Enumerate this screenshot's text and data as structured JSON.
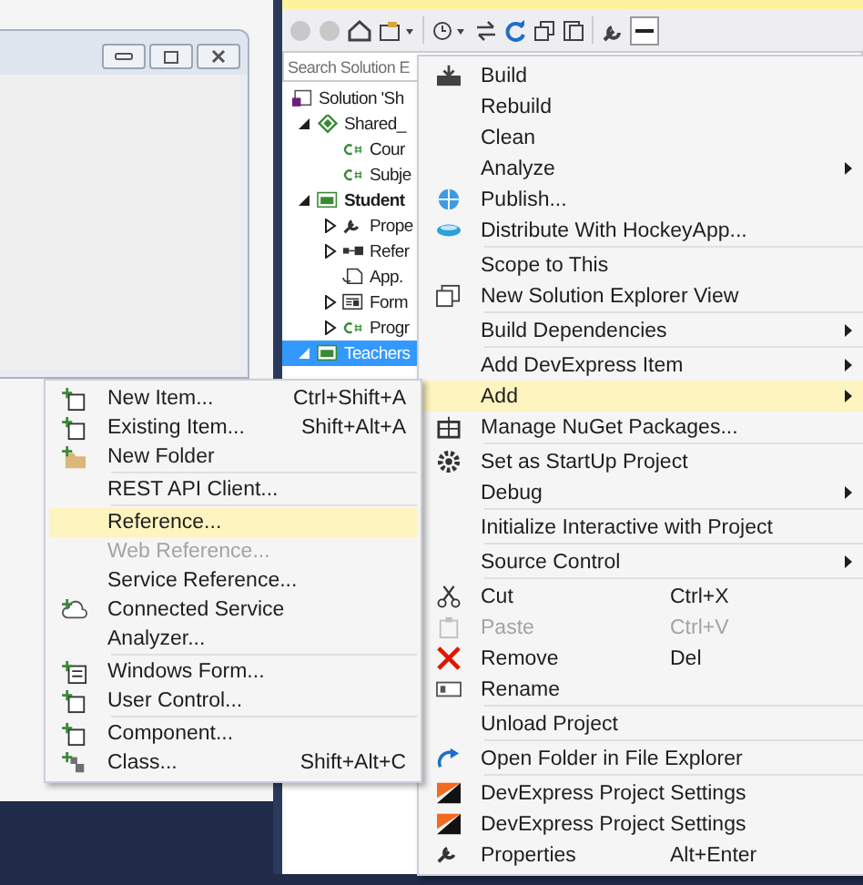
{
  "solution_explorer": {
    "search": {
      "placeholder": "Search Solution E"
    },
    "tree": [
      {
        "label": "Solution 'Sh",
        "kind": "solution",
        "selected": false,
        "bold": false,
        "children": [
          {
            "label": "Shared_",
            "kind": "shared",
            "expanded": true,
            "selected": false,
            "bold": false,
            "children": [
              {
                "label": "Cour",
                "kind": "code",
                "selected": false,
                "bold": false
              },
              {
                "label": "Subje",
                "kind": "code",
                "selected": false,
                "bold": false
              }
            ]
          },
          {
            "label": "Student",
            "kind": "project",
            "expanded": true,
            "selected": false,
            "bold": true,
            "children": [
              {
                "label": "Prope",
                "kind": "properties",
                "expanded": false,
                "selected": false,
                "bold": false
              },
              {
                "label": "Refer",
                "kind": "references",
                "expanded": false,
                "selected": false,
                "bold": false
              },
              {
                "label": "App.",
                "kind": "config",
                "selected": false,
                "bold": false
              },
              {
                "label": "Form",
                "kind": "form",
                "expanded": false,
                "selected": false,
                "bold": false
              },
              {
                "label": "Progr",
                "kind": "code",
                "expanded": false,
                "selected": false,
                "bold": false
              }
            ]
          },
          {
            "label": "Teachers",
            "kind": "project",
            "expanded": true,
            "selected": true,
            "bold": false
          }
        ]
      }
    ]
  },
  "context_menu": {
    "items": [
      {
        "kind": "item",
        "label": "Build",
        "selected": false,
        "disabled": false,
        "submenu": false
      },
      {
        "kind": "item",
        "label": "Rebuild",
        "selected": false,
        "disabled": false,
        "submenu": false
      },
      {
        "kind": "item",
        "label": "Clean",
        "selected": false,
        "disabled": false,
        "submenu": false
      },
      {
        "kind": "item",
        "label": "Analyze",
        "selected": false,
        "disabled": false,
        "submenu": true
      },
      {
        "kind": "item",
        "label": "Publish...",
        "selected": false,
        "disabled": false,
        "submenu": false
      },
      {
        "kind": "item",
        "label": "Distribute With HockeyApp...",
        "selected": false,
        "disabled": false,
        "submenu": false
      },
      {
        "kind": "separator"
      },
      {
        "kind": "item",
        "label": "Scope to This",
        "selected": false,
        "disabled": false,
        "submenu": false
      },
      {
        "kind": "item",
        "label": "New Solution Explorer View",
        "selected": false,
        "disabled": false,
        "submenu": false
      },
      {
        "kind": "separator"
      },
      {
        "kind": "item",
        "label": "Build Dependencies",
        "selected": false,
        "disabled": false,
        "submenu": true
      },
      {
        "kind": "separator"
      },
      {
        "kind": "item",
        "label": "Add DevExpress Item",
        "selected": false,
        "disabled": false,
        "submenu": true
      },
      {
        "kind": "item",
        "label": "Add",
        "selected": true,
        "disabled": false,
        "submenu": true
      },
      {
        "kind": "item",
        "label": "Manage NuGet Packages...",
        "selected": false,
        "disabled": false,
        "submenu": false
      },
      {
        "kind": "separator"
      },
      {
        "kind": "item",
        "label": "Set as StartUp Project",
        "selected": false,
        "disabled": false,
        "submenu": false
      },
      {
        "kind": "item",
        "label": "Debug",
        "selected": false,
        "disabled": false,
        "submenu": true
      },
      {
        "kind": "separator"
      },
      {
        "kind": "item",
        "label": "Initialize Interactive with Project",
        "selected": false,
        "disabled": false,
        "submenu": false
      },
      {
        "kind": "separator"
      },
      {
        "kind": "item",
        "label": "Source Control",
        "selected": false,
        "disabled": false,
        "submenu": true
      },
      {
        "kind": "separator"
      },
      {
        "kind": "item",
        "label": "Cut",
        "shortcut": "Ctrl+X",
        "selected": false,
        "disabled": false,
        "submenu": false
      },
      {
        "kind": "item",
        "label": "Paste",
        "shortcut": "Ctrl+V",
        "selected": false,
        "disabled": true,
        "submenu": false
      },
      {
        "kind": "item",
        "label": "Remove",
        "shortcut": "Del",
        "selected": false,
        "disabled": false,
        "submenu": false
      },
      {
        "kind": "item",
        "label": "Rename",
        "selected": false,
        "disabled": false,
        "submenu": false
      },
      {
        "kind": "separator"
      },
      {
        "kind": "item",
        "label": "Unload Project",
        "selected": false,
        "disabled": false,
        "submenu": false
      },
      {
        "kind": "separator"
      },
      {
        "kind": "item",
        "label": "Open Folder in File Explorer",
        "selected": false,
        "disabled": false,
        "submenu": false
      },
      {
        "kind": "separator"
      },
      {
        "kind": "item",
        "label": "DevExpress Project Settings",
        "selected": false,
        "disabled": false,
        "submenu": false
      },
      {
        "kind": "item",
        "label": "DevExpress Project Settings",
        "selected": false,
        "disabled": false,
        "submenu": false
      },
      {
        "kind": "item",
        "label": "Properties",
        "shortcut": "Alt+Enter",
        "selected": false,
        "disabled": false,
        "submenu": false
      }
    ]
  },
  "add_submenu": {
    "items": [
      {
        "kind": "item",
        "label": "New Item...",
        "shortcut": "Ctrl+Shift+A",
        "selected": false,
        "disabled": false
      },
      {
        "kind": "item",
        "label": "Existing Item...",
        "shortcut": "Shift+Alt+A",
        "selected": false,
        "disabled": false
      },
      {
        "kind": "item",
        "label": "New Folder",
        "selected": false,
        "disabled": false
      },
      {
        "kind": "separator"
      },
      {
        "kind": "item",
        "label": "REST API Client...",
        "selected": false,
        "disabled": false
      },
      {
        "kind": "separator"
      },
      {
        "kind": "item",
        "label": "Reference...",
        "selected": true,
        "disabled": false
      },
      {
        "kind": "item",
        "label": "Web Reference...",
        "selected": false,
        "disabled": true
      },
      {
        "kind": "item",
        "label": "Service Reference...",
        "selected": false,
        "disabled": false
      },
      {
        "kind": "item",
        "label": "Connected Service",
        "selected": false,
        "disabled": false
      },
      {
        "kind": "item",
        "label": "Analyzer...",
        "selected": false,
        "disabled": false
      },
      {
        "kind": "separator"
      },
      {
        "kind": "item",
        "label": "Windows Form...",
        "selected": false,
        "disabled": false
      },
      {
        "kind": "item",
        "label": "User Control...",
        "selected": false,
        "disabled": false
      },
      {
        "kind": "separator"
      },
      {
        "kind": "item",
        "label": "Component...",
        "selected": false,
        "disabled": false
      },
      {
        "kind": "item",
        "label": "Class...",
        "shortcut": "Shift+Alt+C",
        "selected": false,
        "disabled": false
      }
    ]
  }
}
